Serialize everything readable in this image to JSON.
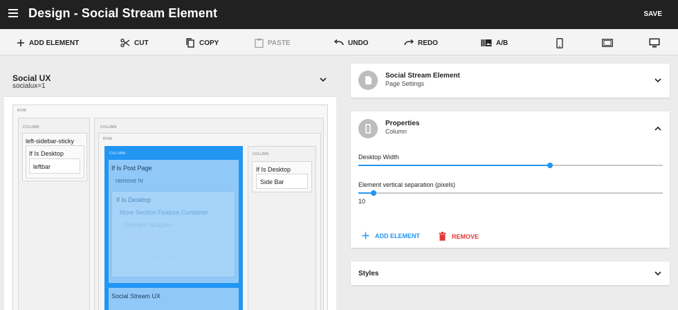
{
  "header": {
    "title": "Design - Social Stream Element",
    "save_label": "SAVE"
  },
  "toolbar": {
    "add_element": "ADD ELEMENT",
    "cut": "CUT",
    "copy": "COPY",
    "paste": "PASTE",
    "undo": "UNDO",
    "redo": "REDO",
    "ab": "A/B"
  },
  "left_panel": {
    "title": "Social UX",
    "subtitle": "socialux=1",
    "tree": {
      "row_tag": "ROW",
      "column_tag": "COLUMN",
      "left_sticky": "left-sidebar-sticky",
      "if_desktop": "If Is Desktop",
      "leftbar": "leftbar",
      "if_post_page": "If Is Post Page",
      "remove_hr": "remove hr",
      "if_desktop_2": "If Is Desktop",
      "more_section": "More Section Feature Container",
      "element_wrapper": "Element Wrapper",
      "faint_1": "Feed Media",
      "faint_2": "Custom Text Feed",
      "social_stream": "Social Stream UX",
      "right_if_desktop": "If Is Desktop",
      "side_bar": "Side Bar"
    }
  },
  "element_panel": {
    "title": "Social Stream Element",
    "subtitle": "Page Settings"
  },
  "properties_panel": {
    "title": "Properties",
    "subtitle": "Column",
    "desktop_width_label": "Desktop Width",
    "desktop_width_fraction": 0.63,
    "separation_label": "Element vertical separation (pixels)",
    "separation_value": "10",
    "separation_fraction": 0.05,
    "add_element": "ADD ELEMENT",
    "remove": "REMOVE"
  },
  "styles_panel": {
    "title": "Styles"
  },
  "colors": {
    "accent": "#2196f3",
    "danger": "#e53935",
    "appbar": "#212121"
  }
}
